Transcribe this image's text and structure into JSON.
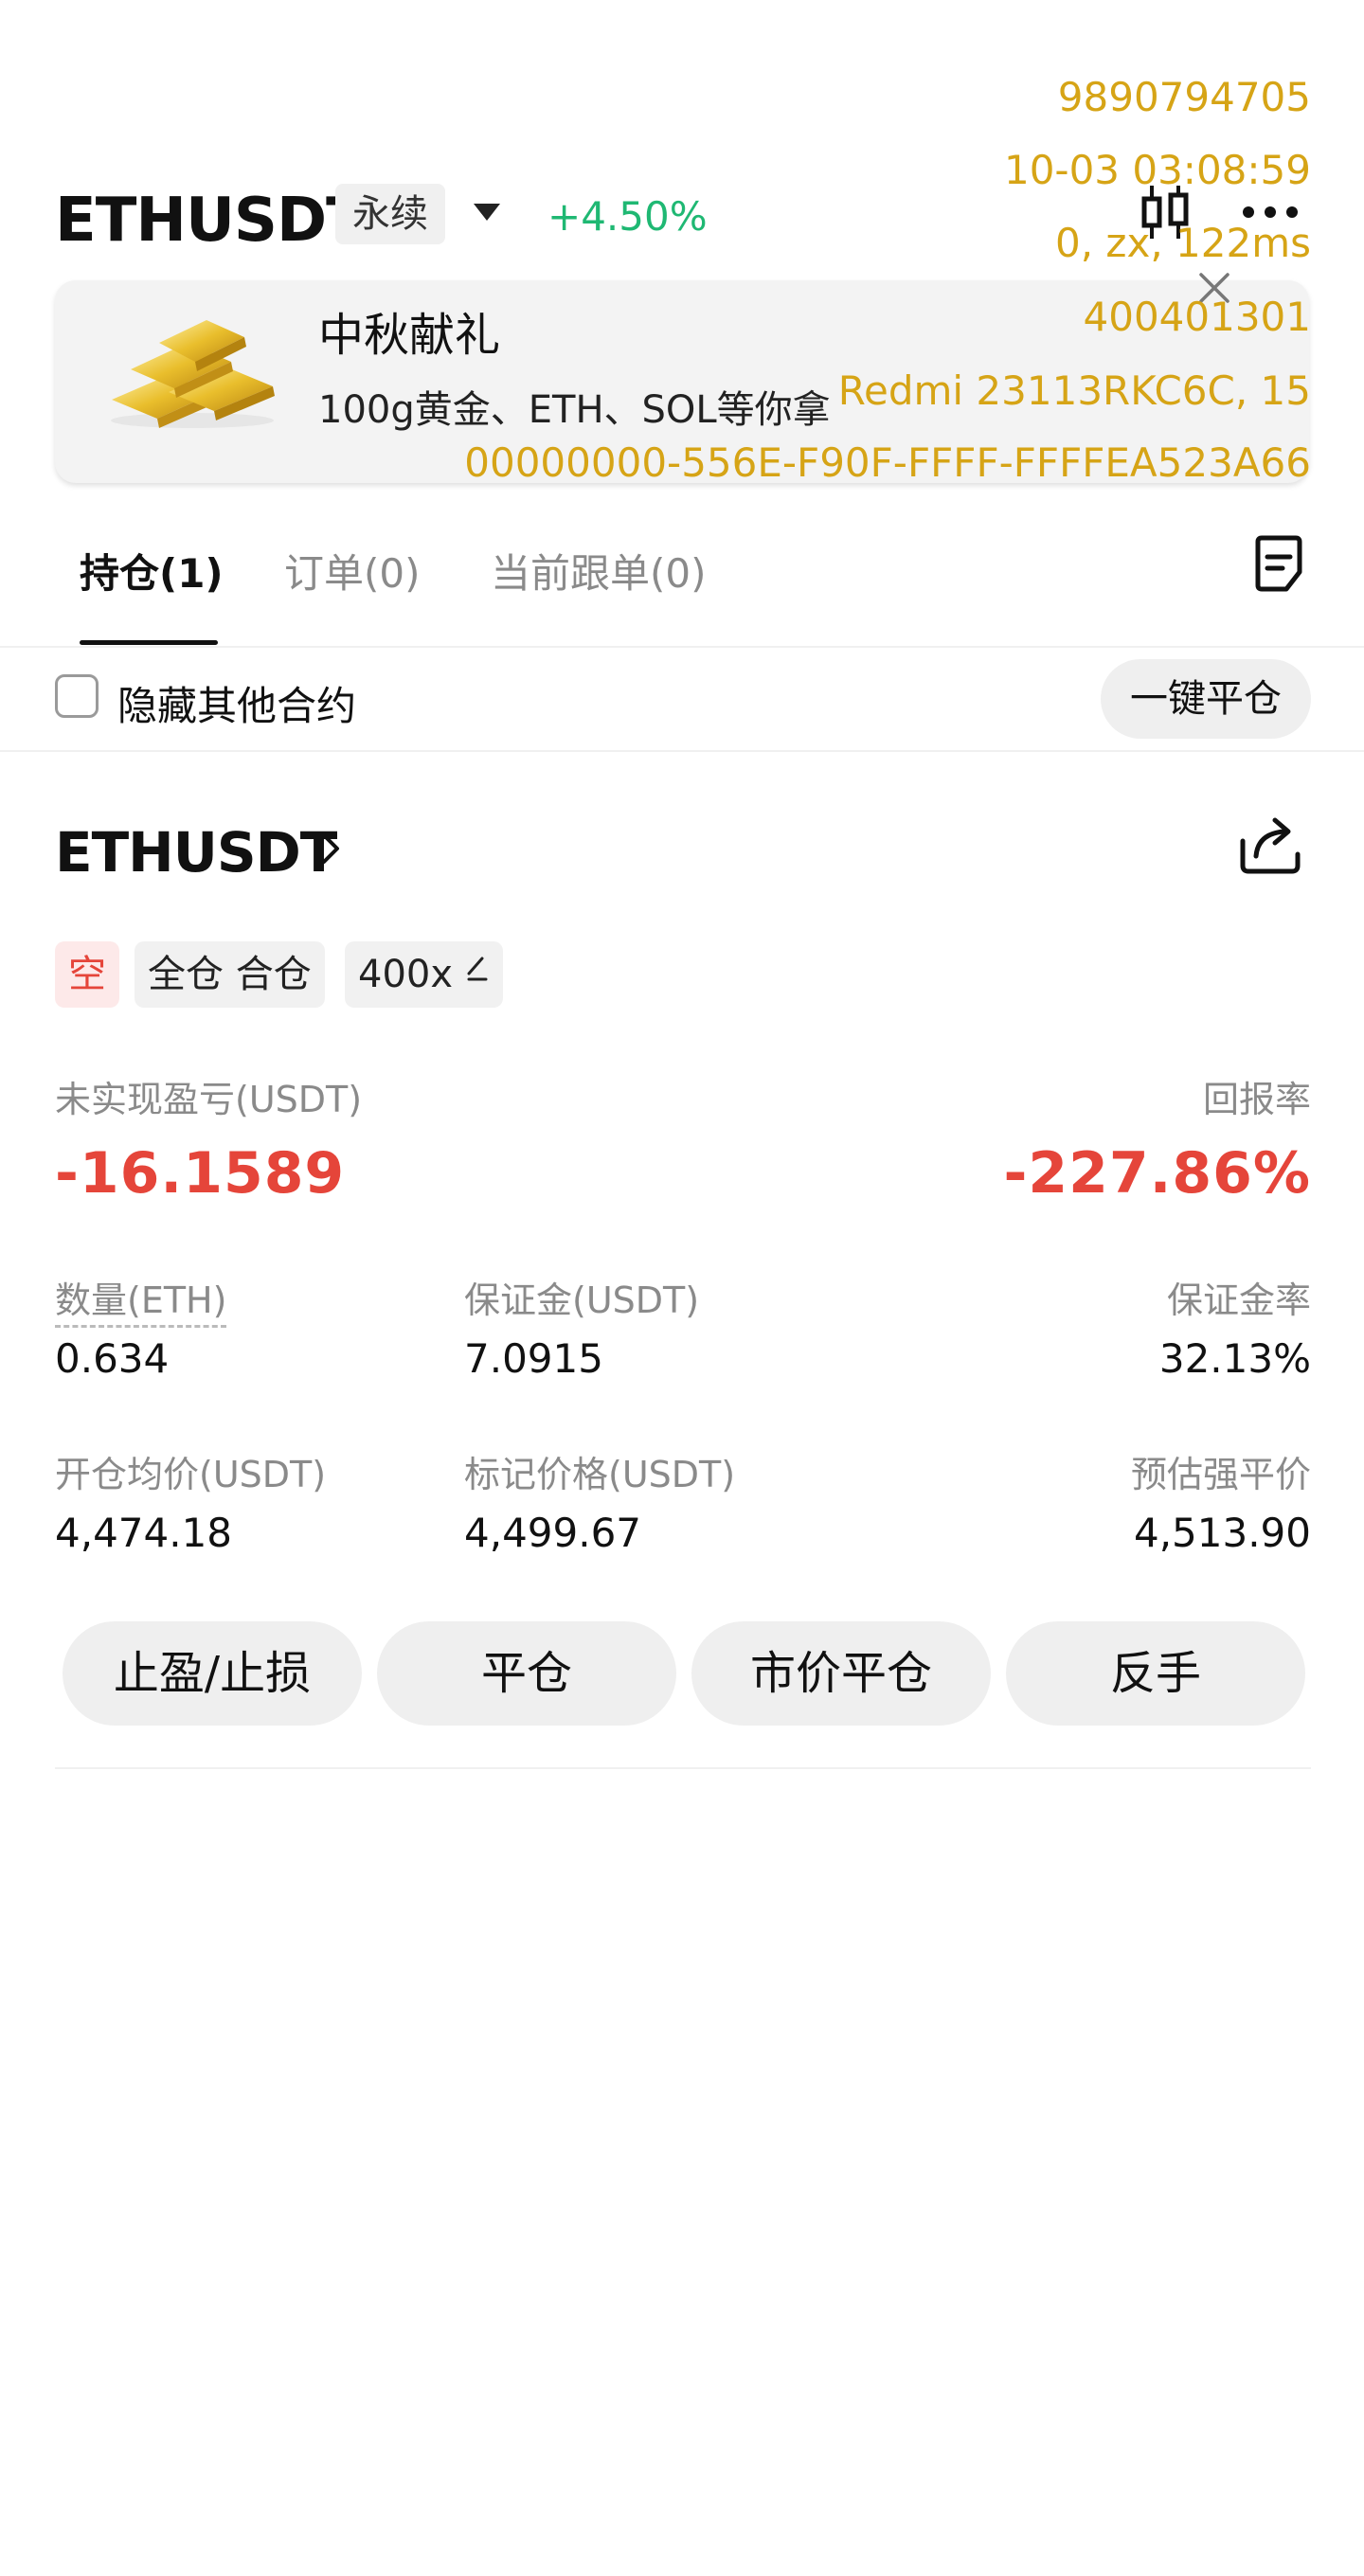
{
  "header": {
    "pair": "ETHUSDT",
    "contract_type": "永续",
    "change": "+4.50%"
  },
  "overlay": {
    "line1": "9890794705",
    "line2": "10-03 03:08:59",
    "line3": "0, zx, 122ms",
    "line4": "400401301",
    "line5": "Redmi 23113RKC6C, 15",
    "line6": "00000000-556E-F90F-FFFF-FFFFEA523A66"
  },
  "banner": {
    "title": "中秋献礼",
    "subtitle": "100g黄金、ETH、SOL等你拿"
  },
  "tabs": [
    {
      "label": "持仓(1)"
    },
    {
      "label": "订单(0)"
    },
    {
      "label": "当前跟单(0)"
    }
  ],
  "filter": {
    "hide_others_label": "隐藏其他合约",
    "close_all_label": "一键平仓"
  },
  "position": {
    "symbol": "ETHUSDT",
    "side_tag": "空",
    "margin_mode_tag": "全仓 合仓",
    "leverage_tag": "400x",
    "unrealized_pnl_label": "未实现盈亏(USDT)",
    "unrealized_pnl_value": "-16.1589",
    "roe_label": "回报率",
    "roe_value": "-227.86%",
    "qty_label": "数量(ETH)",
    "qty_value": "0.634",
    "margin_label": "保证金(USDT)",
    "margin_value": "7.0915",
    "margin_ratio_label": "保证金率",
    "margin_ratio_value": "32.13%",
    "entry_label": "开仓均价(USDT)",
    "entry_value": "4,474.18",
    "mark_label": "标记价格(USDT)",
    "mark_value": "4,499.67",
    "liq_label": "预估强平价",
    "liq_value": "4,513.90"
  },
  "actions": {
    "tp_sl": "止盈/止损",
    "close": "平仓",
    "market_close": "市价平仓",
    "reverse": "反手"
  },
  "colors": {
    "up": "#1fb873",
    "down": "#e5453a",
    "overlay": "#d6a416"
  },
  "icons": [
    "caret-down-icon",
    "candlestick-icon",
    "more-icon",
    "gold-bars-image",
    "close-icon",
    "document-icon",
    "chevron-right-icon",
    "share-icon",
    "edit-pencil-icon"
  ]
}
